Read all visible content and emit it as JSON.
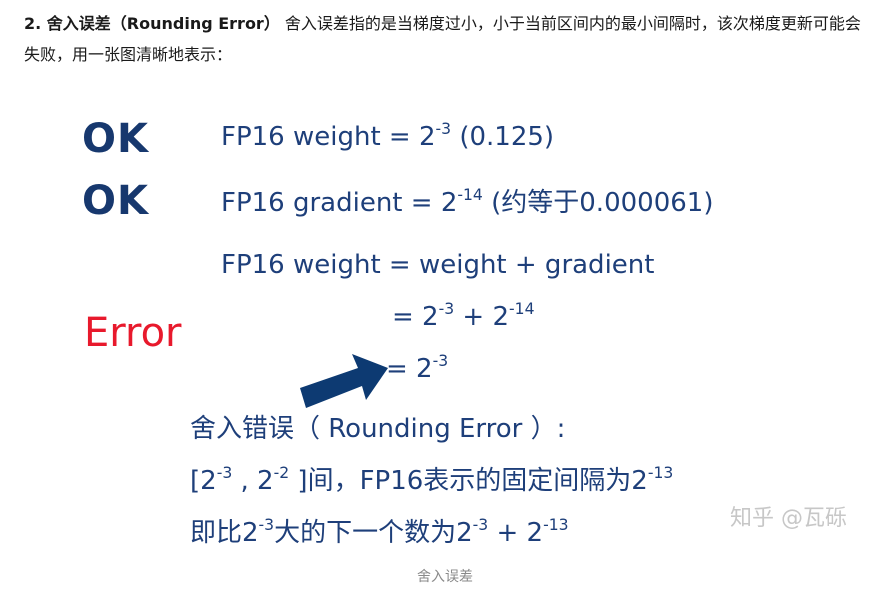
{
  "paragraph": {
    "heading": "2. 舍入误差（Rounding Error）",
    "body": " 舍入误差指的是当梯度过小，小于当前区间内的最小间隔时，该次梯度更新可能会失败，用一张图清晰地表示："
  },
  "figure": {
    "ok_label_1": "OK",
    "ok_label_2": "OK",
    "error_label": "Error",
    "line1": {
      "prefix": "FP16 weight = 2",
      "exp": "-3",
      "suffix": " (0.125)"
    },
    "line2": {
      "prefix": "FP16 gradient = 2",
      "exp": "-14",
      "suffix": " (约等于0.000061)"
    },
    "line3": {
      "text": "FP16 weight = weight + gradient"
    },
    "line4": {
      "prefix": "= 2",
      "exp1": "-3",
      "mid": " + 2",
      "exp2": "-14"
    },
    "line5": {
      "prefix": "= 2",
      "exp": "-3"
    },
    "note1": {
      "text": "舍入错误（ Rounding Error ）:"
    },
    "note2": {
      "p1": "[2",
      "e1": "-3",
      "p2": " , 2",
      "e2": "-2",
      "p3": " ]间，FP16表示的固定间隔为2",
      "e3": "-13"
    },
    "note3": {
      "p1": "即比2",
      "e1": "-3",
      "p2": "大的下一个数为2",
      "e2": "-3",
      "p3": " + 2",
      "e3": "-13"
    },
    "arrow_icon": "arrow-right-icon",
    "watermark": "知乎 @瓦砾",
    "colors": {
      "ok": "#17386e",
      "error": "#e8192c",
      "text": "#1e3f7a",
      "arrow": "#0d3a72"
    }
  },
  "caption": "舍入误差"
}
